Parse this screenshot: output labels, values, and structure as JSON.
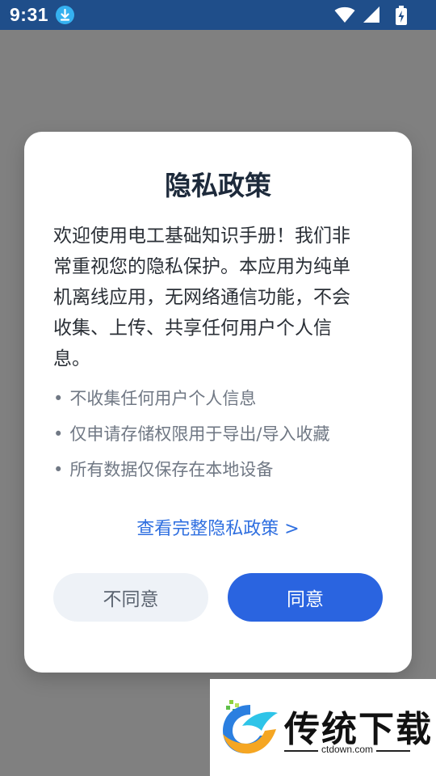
{
  "status_bar": {
    "time": "9:31",
    "icons": [
      "download-icon",
      "wifi-icon",
      "signal-icon",
      "battery-charging-icon"
    ]
  },
  "dialog": {
    "title": "隐私政策",
    "paragraph_lines": [
      "欢迎使用电工基础知识手册！我们非",
      "常重视您的隐私保护。本应用为纯单",
      "机离线应用，无网络通信功能，不会",
      "收集、上传、共享任何用户个人信",
      "息。"
    ],
    "bullet_mark": "•",
    "bullets": [
      "不收集任何用户个人信息",
      "仅申请存储权限用于导出/导入收藏",
      "所有数据仅保存在本地设备"
    ],
    "policy_link": "查看完整隐私政策 >",
    "disagree_label": "不同意",
    "agree_label": "同意"
  },
  "watermark": {
    "text": "传统下载",
    "domain": "ctdown.com"
  },
  "colors": {
    "overlay": "#808080",
    "status_bar": "#1f4e8a",
    "accent": "#2a64e0",
    "link": "#2f6fe0",
    "secondary_button": "#eef2f7"
  }
}
